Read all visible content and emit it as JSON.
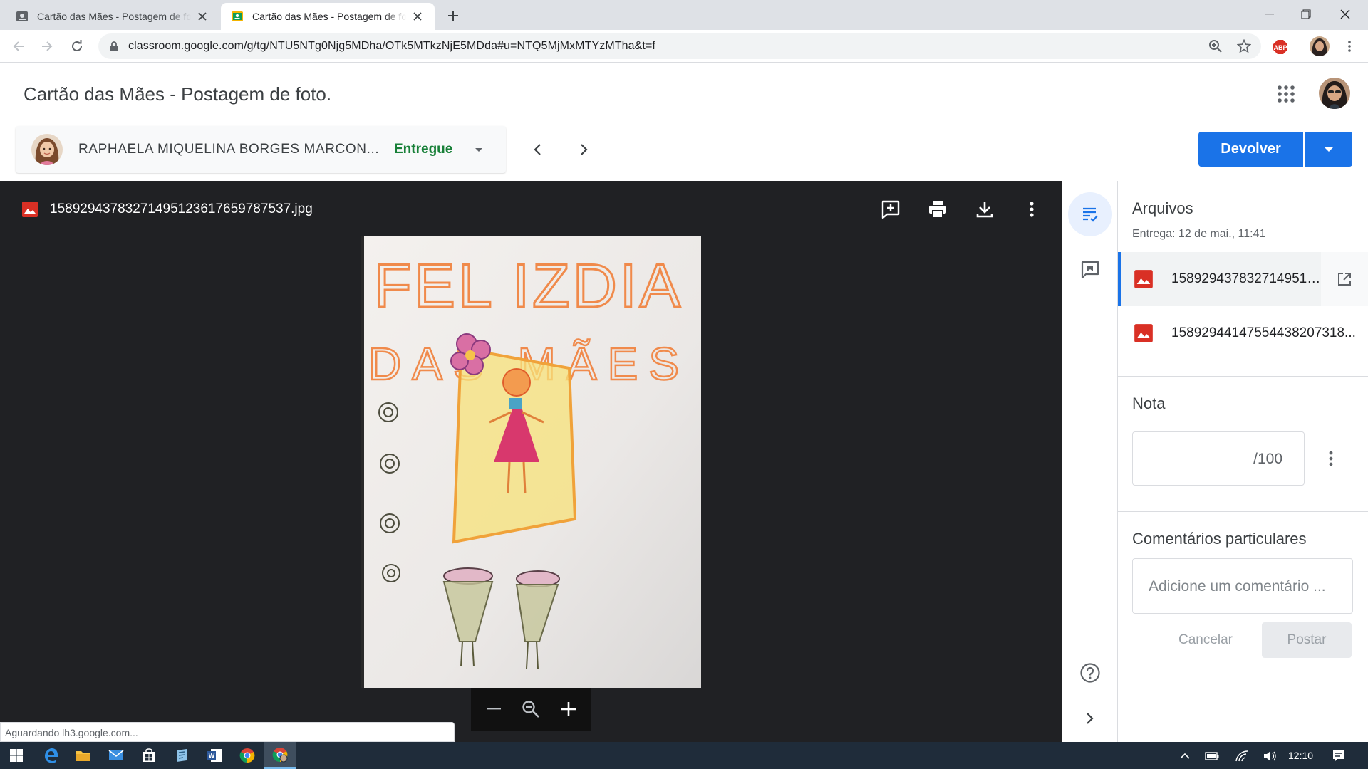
{
  "browser": {
    "tabs": [
      {
        "title": "Cartão das Mães - Postagem de foto.",
        "active": false
      },
      {
        "title": "Cartão das Mães - Postagem de foto.",
        "active": true
      }
    ],
    "url": "classroom.google.com/g/tg/NTU5NTg0Njg5MDha/OTk5MTkzNjE5MDda#u=NTQ5MjMxMTYzMTha&t=f"
  },
  "header": {
    "title": "Cartão das Mães - Postagem de foto."
  },
  "student": {
    "name": "RAPHAELA MIQUELINA BORGES MARCON...",
    "status": "Entregue"
  },
  "actions": {
    "return_label": "Devolver"
  },
  "viewer": {
    "file_name": "15892943783271495123617659787537.jpg",
    "drawing_text": {
      "line1": "FEL IZDIA",
      "line2": "DAS MÃES"
    }
  },
  "panel": {
    "files_title": "Arquivos",
    "delivery": "Entrega: 12 de mai., 11:41",
    "files": [
      {
        "name": "15892943783271495123617659787537.jpg"
      },
      {
        "name": "15892944147554438207318..."
      }
    ],
    "grade_title": "Nota",
    "grade_suffix": "/100",
    "comments_title": "Comentários particulares",
    "comment_placeholder": "Adicione um comentário ...",
    "cancel_label": "Cancelar",
    "post_label": "Postar"
  },
  "status_bar": "Aguardando lh3.google.com...",
  "taskbar": {
    "time": "12:10"
  },
  "colors": {
    "accent": "#1a73e8",
    "status_green": "#188038",
    "viewer_bg": "#202124",
    "taskbar": "#1f2c3a",
    "file_icon_red": "#d93025"
  }
}
